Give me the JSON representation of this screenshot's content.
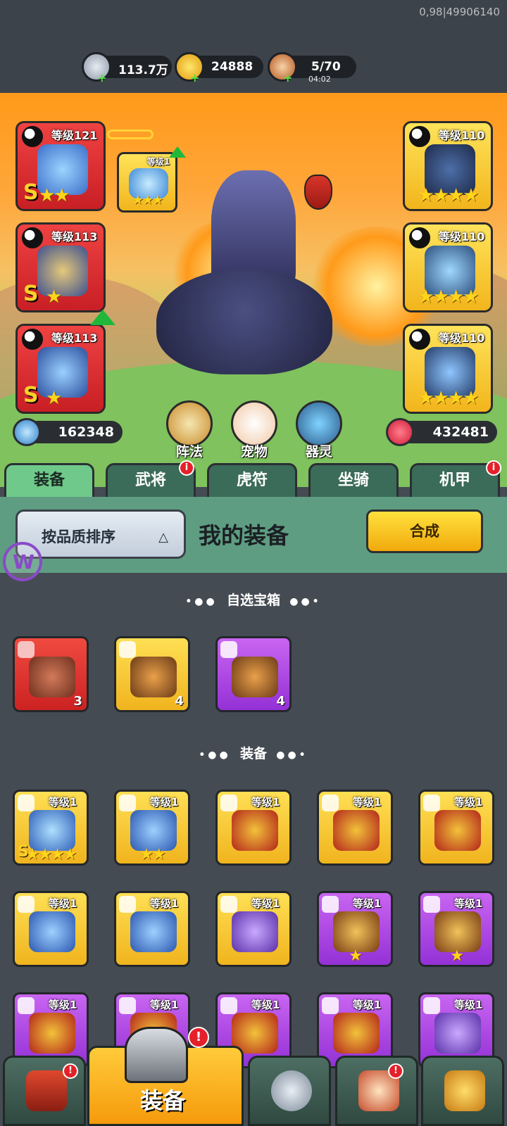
{
  "build_info": "0,98|49906140",
  "resources": {
    "silver": "113.7万",
    "gold": "24888",
    "stamina": "5/70",
    "stamina_timer": "04:02"
  },
  "hero_slots": {
    "left": [
      {
        "level": "等级121",
        "grade": "S",
        "stars": "★★"
      },
      {
        "level": "等级113",
        "grade": "S",
        "stars": "★"
      },
      {
        "level": "等级113",
        "grade": "S",
        "stars": "★"
      }
    ],
    "chained": {
      "level": "等级1",
      "stars": "★★★"
    },
    "right": [
      {
        "level": "等级110",
        "stars": "★★★★"
      },
      {
        "level": "等级110",
        "stars": "★★★★"
      },
      {
        "level": "等级110",
        "stars": "★★★★"
      }
    ]
  },
  "buttons": {
    "formation": "阵法",
    "pet": "宠物",
    "spirit": "器灵"
  },
  "stats": {
    "attack": "162348",
    "hp": "432481"
  },
  "tabs": [
    {
      "label": "装备",
      "active": true
    },
    {
      "label": "武将",
      "badge": "i"
    },
    {
      "label": "虎符"
    },
    {
      "label": "坐骑"
    },
    {
      "label": "机甲",
      "badge": "i"
    }
  ],
  "filter": {
    "sort_label": "按品质排序",
    "sort_icon": "△",
    "title": "我的装备",
    "combine": "合成"
  },
  "chest_section": {
    "title": "自选宝箱",
    "items": [
      {
        "color": "red",
        "count": "3"
      },
      {
        "color": "gold",
        "count": "4"
      },
      {
        "color": "purple",
        "count": "4"
      }
    ]
  },
  "equip_section": {
    "title": "装备",
    "items": [
      {
        "color": "gold",
        "level": "等级1",
        "grade": "S",
        "stars": "★★★★"
      },
      {
        "color": "gold",
        "level": "等级1",
        "stars": "★★"
      },
      {
        "color": "gold",
        "level": "等级1",
        "stars": ""
      },
      {
        "color": "gold",
        "level": "等级1",
        "stars": ""
      },
      {
        "color": "gold",
        "level": "等级1",
        "stars": ""
      },
      {
        "color": "gold",
        "level": "等级1",
        "stars": ""
      },
      {
        "color": "gold",
        "level": "等级1",
        "stars": ""
      },
      {
        "color": "gold",
        "level": "等级1",
        "stars": ""
      },
      {
        "color": "purple",
        "level": "等级1",
        "stars": "★"
      },
      {
        "color": "purple",
        "level": "等级1",
        "stars": "★"
      },
      {
        "color": "purple",
        "level": "等级1",
        "stars": ""
      },
      {
        "color": "purple",
        "level": "等级1",
        "stars": ""
      },
      {
        "color": "purple",
        "level": "等级1",
        "stars": ""
      },
      {
        "color": "purple",
        "level": "等级1",
        "stars": ""
      },
      {
        "color": "purple",
        "level": "等级1",
        "stars": ""
      }
    ]
  },
  "bottom_nav": {
    "active_label": "装备",
    "badge": "!"
  },
  "colors": {
    "accent_green": "#5e9d82",
    "gold": "#f2b51c",
    "red": "#e4212a",
    "purple": "#9431d6"
  }
}
